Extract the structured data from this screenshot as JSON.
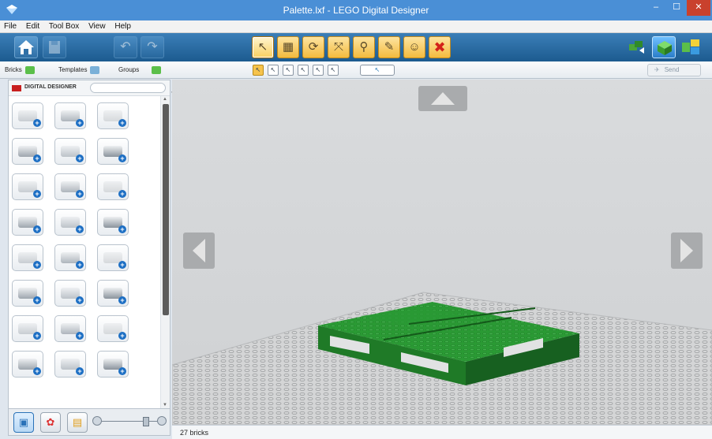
{
  "window": {
    "title": "Palette.lxf - LEGO Digital Designer",
    "min_glyph": "–",
    "max_glyph": "☐",
    "close_glyph": "✕"
  },
  "menu": [
    "File",
    "Edit",
    "Tool Box",
    "View",
    "Help"
  ],
  "toolbar": {
    "home_icon": "home-icon",
    "save_icon": "save-icon",
    "undo_icon": "undo-icon",
    "redo_icon": "redo-icon",
    "tools": [
      {
        "name": "select-tool",
        "glyph": "↖"
      },
      {
        "name": "clone-tool",
        "glyph": "▦"
      },
      {
        "name": "hinge-tool",
        "glyph": "⟳"
      },
      {
        "name": "hinge-align-tool",
        "glyph": "⤧"
      },
      {
        "name": "flex-tool",
        "glyph": "⚲"
      },
      {
        "name": "paint-tool",
        "glyph": "✎"
      },
      {
        "name": "hide-tool",
        "glyph": "☺"
      },
      {
        "name": "delete-tool",
        "glyph": "✖"
      }
    ],
    "right_tools": [
      "build-guide-icon",
      "view-mode-icon",
      "sort-bricks-icon"
    ]
  },
  "tabs": {
    "bricks": "Bricks",
    "templates": "Templates",
    "groups": "Groups"
  },
  "send": {
    "label": "Send",
    "icon": "send-icon"
  },
  "palette": {
    "brand": "DIGITAL DESIGNER",
    "search_placeholder": "",
    "collapse_glyph": "«",
    "bricks_rows": 8,
    "bricks_cols": 3
  },
  "bottom_controls": [
    "brick-palette-icon",
    "color-palette-icon",
    "model-icon"
  ],
  "status": {
    "brick_count": "27 bricks"
  },
  "colors": {
    "titlebar": "#4a8fd6",
    "toolbar": "#2a6ea3",
    "lego_green": "#238b2c",
    "baseplate": "#d8d8d8"
  }
}
